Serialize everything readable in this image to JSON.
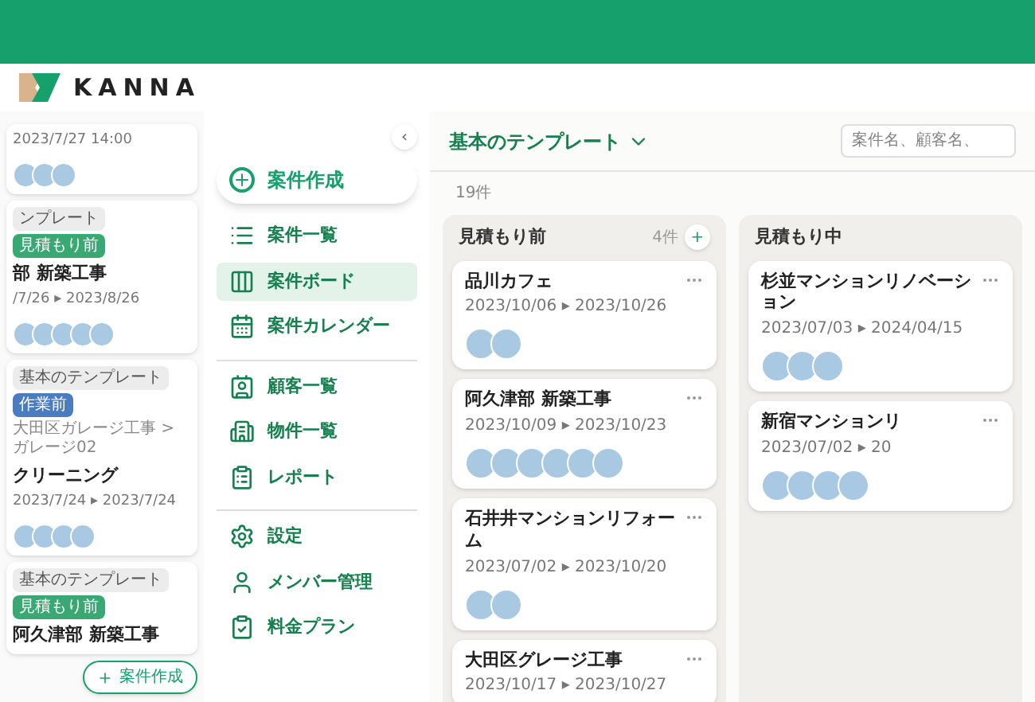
{
  "brand": {
    "name": "KANNA"
  },
  "phone": {
    "cards": [
      {
        "dates": "2023/7/27 14:00",
        "avatars": [
          {
            "kind": "photo"
          },
          {
            "kind": "photo"
          },
          {
            "kind": "photo"
          }
        ]
      },
      {
        "tags": [
          {
            "label": "ンプレート",
            "kind": "template"
          },
          {
            "label": "見積もり前",
            "kind": "estimate"
          }
        ],
        "title": "部 新築工事",
        "dates": "/7/26 ▸ 2023/8/26",
        "avatars": [
          {
            "kind": "photo"
          },
          {
            "kind": "photo"
          },
          {
            "kind": "photo"
          },
          {
            "kind": "photo"
          },
          {
            "kind": "photo"
          }
        ]
      },
      {
        "tags": [
          {
            "label": "基本のテンプレート",
            "kind": "template"
          },
          {
            "label": "作業前",
            "kind": "work"
          }
        ],
        "path": "大田区ガレージ工事 > ガレージ02",
        "title": "クリーニング",
        "dates": "2023/7/24 ▸ 2023/7/24",
        "avatars": [
          {
            "kind": "photo"
          },
          {
            "kind": "photo"
          },
          {
            "kind": "photo"
          },
          {
            "kind": "photo"
          }
        ]
      },
      {
        "tags": [
          {
            "label": "基本のテンプレート",
            "kind": "template"
          },
          {
            "label": "見積もり前",
            "kind": "estimate"
          }
        ],
        "title": "阿久津部 新築工事"
      }
    ],
    "fab": {
      "label": "案件作成"
    }
  },
  "sidebar": {
    "collapse": "‹",
    "create": {
      "label": "案件作成"
    },
    "groups": [
      [
        {
          "label": "案件一覧",
          "selected": false
        },
        {
          "label": "案件ボード",
          "selected": true
        },
        {
          "label": "案件カレンダー",
          "selected": false
        }
      ],
      [
        {
          "label": "顧客一覧",
          "selected": false
        },
        {
          "label": "物件一覧",
          "selected": false
        },
        {
          "label": "レポート",
          "selected": false
        }
      ],
      [
        {
          "label": "設定",
          "selected": false
        },
        {
          "label": "メンバー管理",
          "selected": false
        },
        {
          "label": "料金プラン",
          "selected": false
        }
      ]
    ]
  },
  "main": {
    "template": "基本のテンプレート",
    "search": {
      "placeholder": "案件名、顧客名、"
    },
    "count": "19件",
    "columns": [
      {
        "title": "見積もり前",
        "count": "4件",
        "add": "+",
        "cards": [
          {
            "title": "品川カフェ",
            "dates": "2023/10/06 ▸ 2023/10/26",
            "avatars": [
              {
                "kind": "photo"
              },
              {
                "kind": "photo"
              }
            ]
          },
          {
            "title": "阿久津部 新築工事",
            "dates": "2023/10/09 ▸ 2023/10/23",
            "avatars": [
              {
                "kind": "photo"
              },
              {
                "kind": "photo"
              },
              {
                "kind": "photo"
              },
              {
                "kind": "photo"
              },
              {
                "kind": "photo"
              },
              {
                "kind": "photo"
              }
            ]
          },
          {
            "title": "石井井マンションリフォーム",
            "dates": "2023/07/02 ▸ 2023/10/20",
            "avatars": [
              {
                "kind": "photo"
              },
              {
                "kind": "photo"
              }
            ]
          },
          {
            "title": "大田区グレージ工事",
            "dates": "2023/10/17 ▸ 2023/10/27"
          }
        ]
      },
      {
        "title": "見積もり中",
        "cards": [
          {
            "title": "杉並マンションリノベーション",
            "dates": "2023/07/03 ▸ 2024/04/15",
            "avatars": [
              {
                "kind": "photo"
              },
              {
                "kind": "photo"
              },
              {
                "kind": "photo"
              }
            ]
          },
          {
            "title": "新宿マンションリ",
            "dates": "2023/07/02 ▸ 20",
            "avatars": [
              {
                "kind": "photo"
              },
              {
                "kind": "photo"
              },
              {
                "kind": "photo"
              },
              {
                "kind": "photo"
              }
            ]
          }
        ]
      }
    ]
  }
}
